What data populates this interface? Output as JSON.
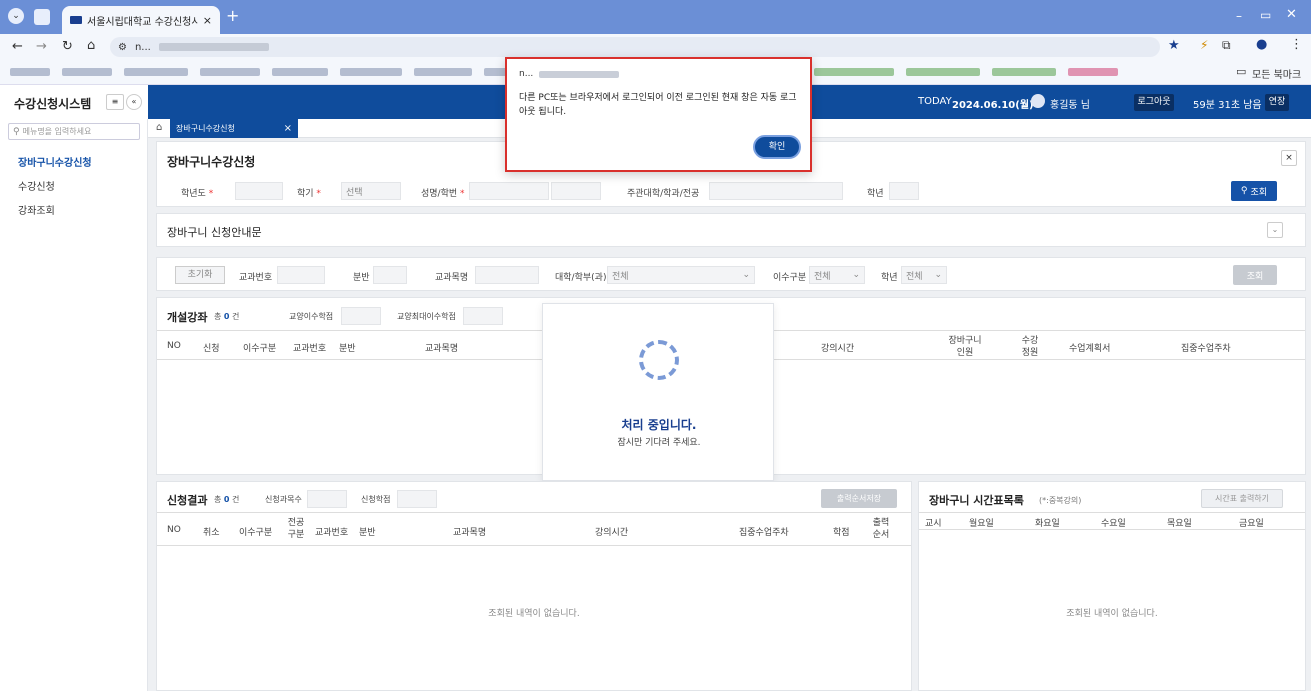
{
  "browser": {
    "tab_title": "서울시립대학교 수강신청시스",
    "address": "n...",
    "all_bookmarks": "모든 북마크"
  },
  "app": {
    "title": "수강신청시스템",
    "today_label": "TODAY",
    "today_date": "2024.06.10(월)",
    "user": "홍길동 님",
    "logout": "로그아웃",
    "timer": "59분 31초 남음",
    "extend": "연장"
  },
  "sidebar": {
    "search_placeholder": "메뉴명을 입력하세요",
    "items": [
      {
        "label": "장바구니수강신청"
      },
      {
        "label": "수강신청"
      },
      {
        "label": "강좌조회"
      }
    ]
  },
  "page_tab": {
    "label": "장바구니수강신청"
  },
  "page": {
    "title": "장바구니수강신청",
    "search": {
      "year_label": "학년도",
      "term_label": "학기",
      "term_value": "선택",
      "name_label": "성명/학번",
      "dept_label": "주관대학/학과/전공",
      "grade_label": "학년",
      "search_button": "조회"
    },
    "guide_title": "장바구니 신청안내문",
    "filter": {
      "reset": "초기화",
      "course_no": "교과번호",
      "section": "분반",
      "course_name": "교과목명",
      "college": "대학/학부(과)",
      "college_value": "전체",
      "type": "이수구분",
      "type_value": "전체",
      "grade": "학년",
      "grade_value": "전체",
      "search": "조회"
    },
    "open_courses": {
      "title": "개설강좌",
      "count_prefix": "총",
      "count": "0",
      "count_suffix": "건",
      "liberal_credits": "교양이수학점",
      "liberal_max": "교양최대이수학점",
      "columns": [
        "NO",
        "신청",
        "이수구분",
        "교과번호",
        "분반",
        "교과목명",
        "강의시간",
        "장바구니 인원",
        "수강 정원",
        "수업계획서",
        "집중수업주차"
      ]
    },
    "results": {
      "title": "신청결과",
      "count_prefix": "총",
      "count": "0",
      "count_suffix": "건",
      "subjects_count": "신청과목수",
      "credits": "신청학점",
      "print_button": "출력순서저장",
      "columns": [
        "NO",
        "취소",
        "이수구분",
        "전공 구분",
        "교과번호",
        "분반",
        "교과목명",
        "강의시간",
        "집중수업주차",
        "학점",
        "출력 순서"
      ],
      "empty": "조회된 내역이 없습니다."
    },
    "timetable": {
      "title": "장바구니 시간표목록",
      "note": "(*:중복강의)",
      "print_button": "시간표 출력하기",
      "columns": [
        "교시",
        "월요일",
        "화요일",
        "수요일",
        "목요일",
        "금요일"
      ],
      "empty": "조회된 내역이 없습니다."
    }
  },
  "loading": {
    "title": "처리 중입니다.",
    "subtitle": "잠시만 기다려 주세요."
  },
  "dialog": {
    "origin": "n...",
    "message": "다른 PC또는 브라우저에서 로그인되어 이전 로그인된 현재 창은 자동 로그아웃 됩니다.",
    "confirm": "확인"
  },
  "colors": {
    "accent": "#0f4c9c",
    "button": "#1552a8",
    "dialog_border": "#d9302c"
  }
}
